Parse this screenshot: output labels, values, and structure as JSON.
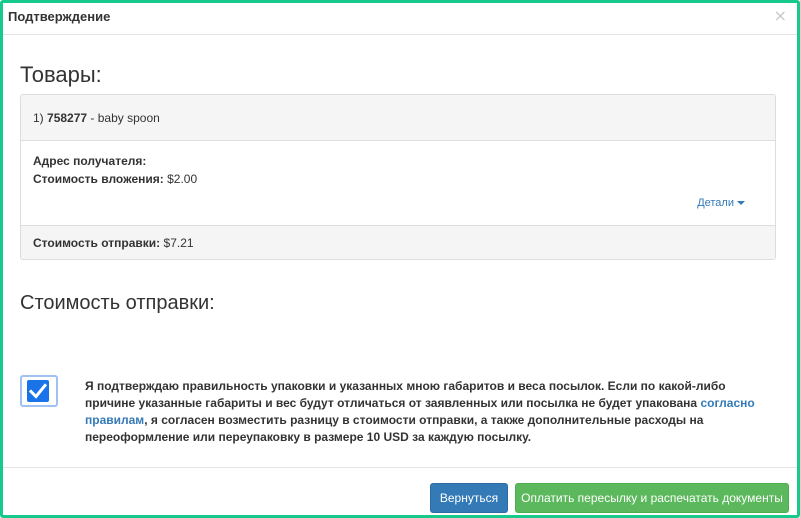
{
  "modal": {
    "title": "Подтверждение",
    "close_symbol": "×"
  },
  "goods": {
    "heading": "Товары:",
    "item_number": "1)",
    "item_id": "758277",
    "item_name": "- baby spoon",
    "address_label": "Адрес получателя:",
    "content_cost_label": "Стоимость вложения:",
    "content_cost_value": "$2.00",
    "details_link": "Детали",
    "shipping_cost_label": "Стоимость отправки:",
    "shipping_cost_value": "$7.21"
  },
  "shipping": {
    "heading": "Стоимость отправки:"
  },
  "confirmation": {
    "checked": true,
    "text_part1": "Я подтверждаю правильность упаковки и указанных мною габаритов и веса посылок. Если по какой-либо причине указанные габариты и вес будут отличаться от заявленных или посылка не будет упакована",
    "link_text": "согласно правилам",
    "text_part2": ", я согласен возместить разницу в стоимости отправки, а также дополнительные расходы на переоформление или переупаковку в размере 10 USD за каждую посылку."
  },
  "buttons": {
    "back_label": "Вернуться",
    "pay_label": "Оплатить пересылку и распечатать документы"
  },
  "colors": {
    "frame": "#18c98c",
    "primary": "#337ab7",
    "success": "#5cb85c",
    "checkbox": "#1a73e8"
  }
}
